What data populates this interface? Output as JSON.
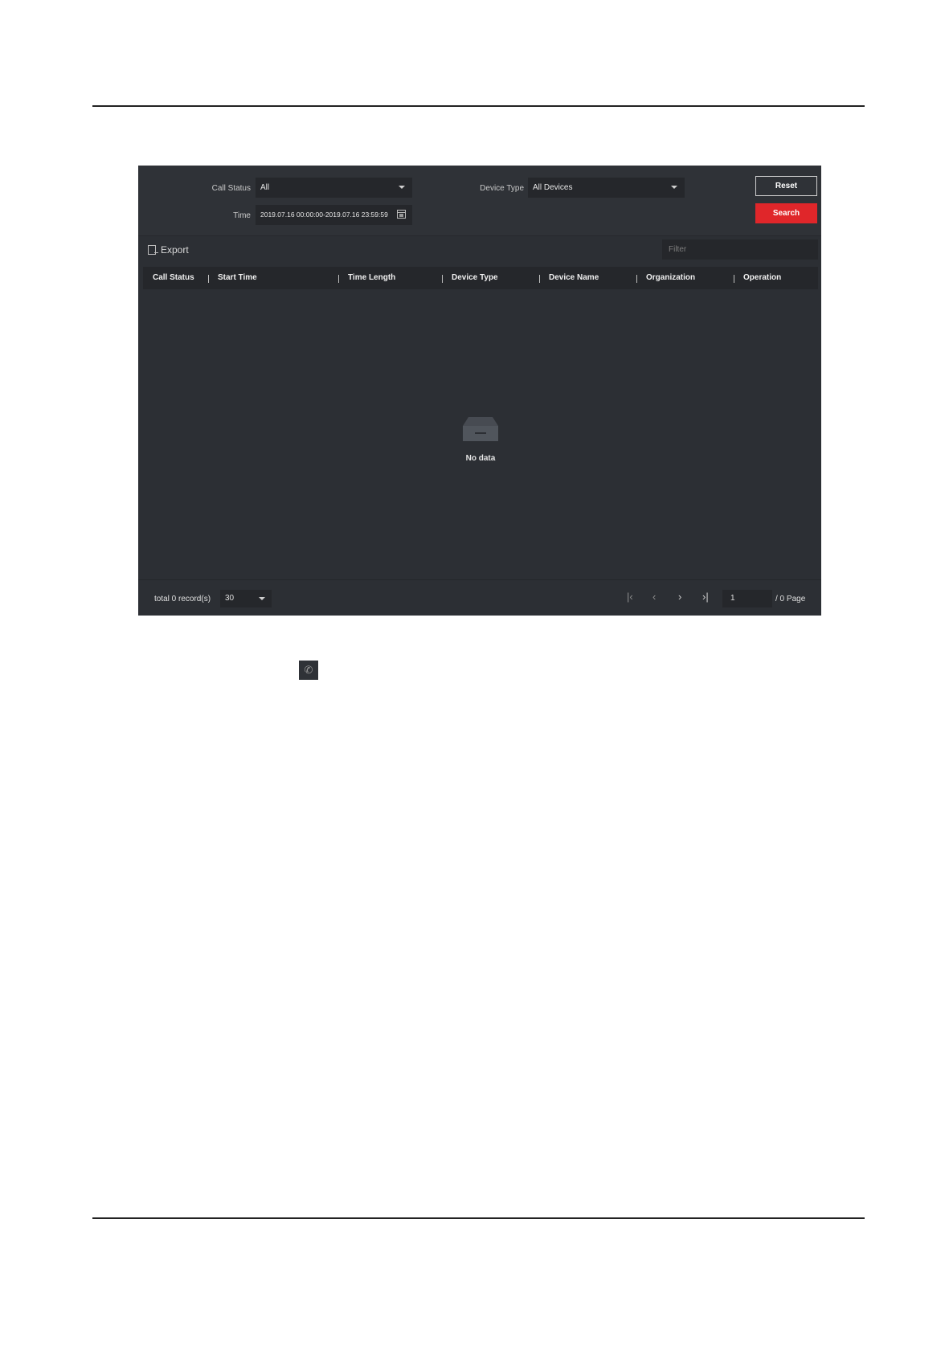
{
  "filters": {
    "call_status_label": "Call Status",
    "call_status_value": "All",
    "device_type_label": "Device Type",
    "device_type_value": "All Devices",
    "time_label": "Time",
    "time_value": "2019.07.16 00:00:00-2019.07.16 23:59:59",
    "reset_label": "Reset",
    "search_label": "Search"
  },
  "toolbar": {
    "export_label": "Export",
    "filter_placeholder": "Filter"
  },
  "table": {
    "columns": [
      "Call Status",
      "Start Time",
      "Time Length",
      "Device Type",
      "Device Name",
      "Organization",
      "Operation"
    ],
    "empty_text": "No data"
  },
  "footer": {
    "records_text": "total 0 record(s)",
    "page_size": "30",
    "current_page": "1",
    "page_total": "/ 0 Page"
  },
  "icons": {
    "first_page": "first-page-icon",
    "prev_page": "prev-page-icon",
    "next_page": "next-page-icon",
    "last_page": "last-page-icon",
    "inline_call": "call-log-icon"
  },
  "colors": {
    "panel_bg": "#2c2f34",
    "search_button": "#e0262a"
  }
}
